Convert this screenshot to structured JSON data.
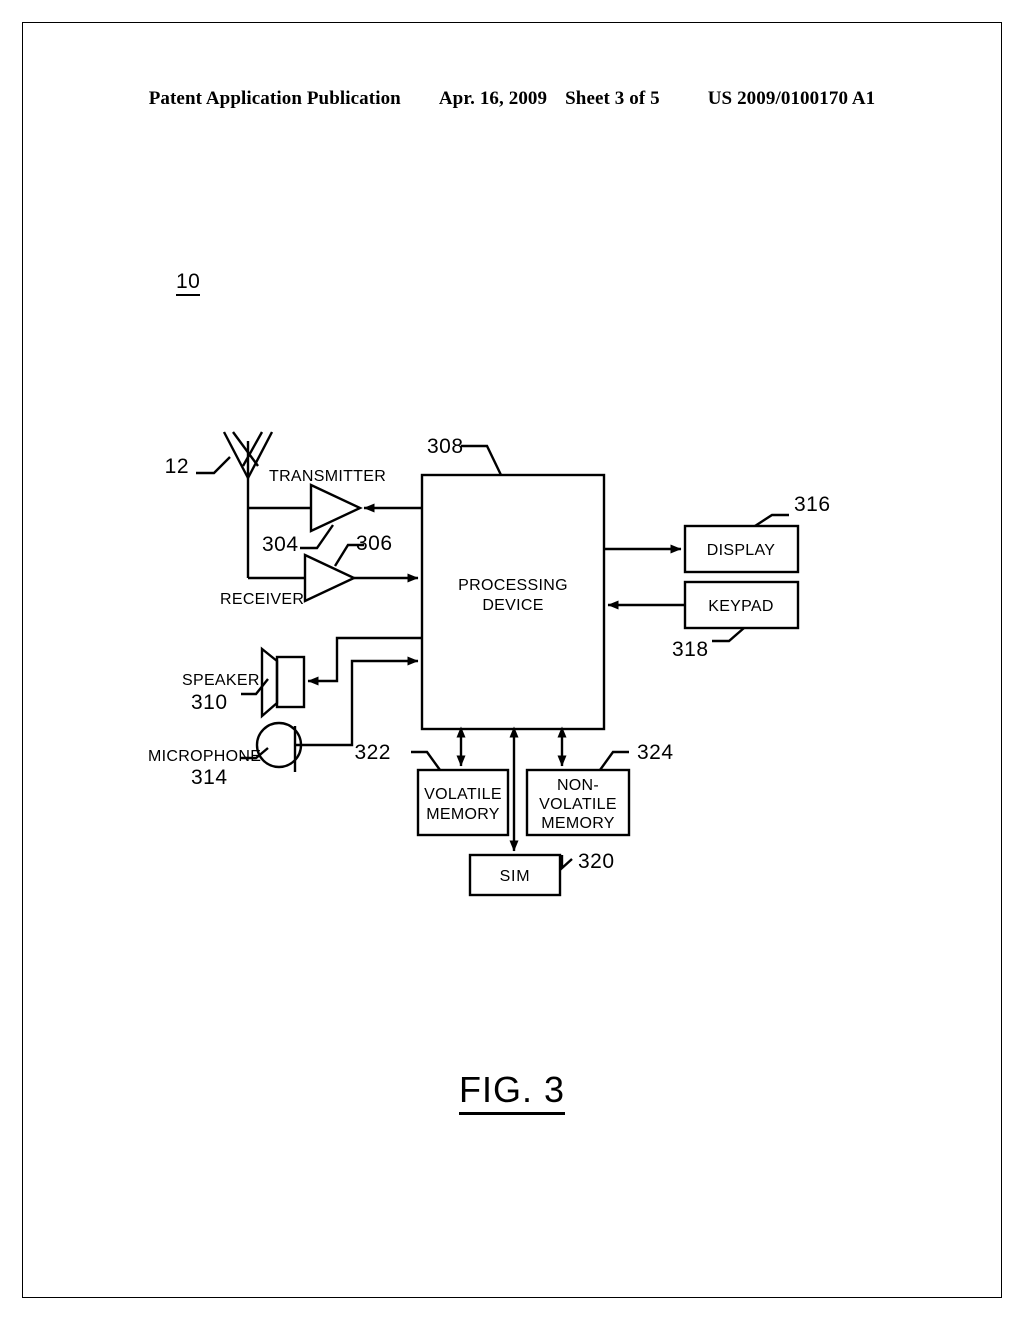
{
  "header": {
    "left": "Patent Application Publication",
    "date": "Apr. 16, 2009",
    "sheet": "Sheet 3 of 5",
    "pubnum": "US 2009/0100170 A1"
  },
  "figure": {
    "caption": "FIG. 3",
    "system_ref": "10",
    "blocks": {
      "processing": {
        "line1": "PROCESSING",
        "line2": "DEVICE",
        "ref": "308"
      },
      "display": {
        "label": "DISPLAY",
        "ref": "316"
      },
      "keypad": {
        "label": "KEYPAD",
        "ref": "318"
      },
      "volatile": {
        "line1": "VOLATILE",
        "line2": "MEMORY",
        "ref": "322"
      },
      "nonvolatile": {
        "line1": "NON-",
        "line2": "VOLATILE",
        "line3": "MEMORY",
        "ref": "324"
      },
      "sim": {
        "label": "SIM",
        "ref": "320"
      },
      "transmitter": {
        "label": "TRANSMITTER",
        "ref": "304"
      },
      "receiver": {
        "label": "RECEIVER",
        "ref": "306"
      },
      "speaker": {
        "label": "SPEAKER",
        "ref": "310"
      },
      "microphone": {
        "label": "MICROPHONE",
        "ref": "314"
      },
      "antenna": {
        "ref": "12"
      }
    }
  },
  "colors": {
    "ink": "#000000",
    "paper": "#ffffff"
  }
}
